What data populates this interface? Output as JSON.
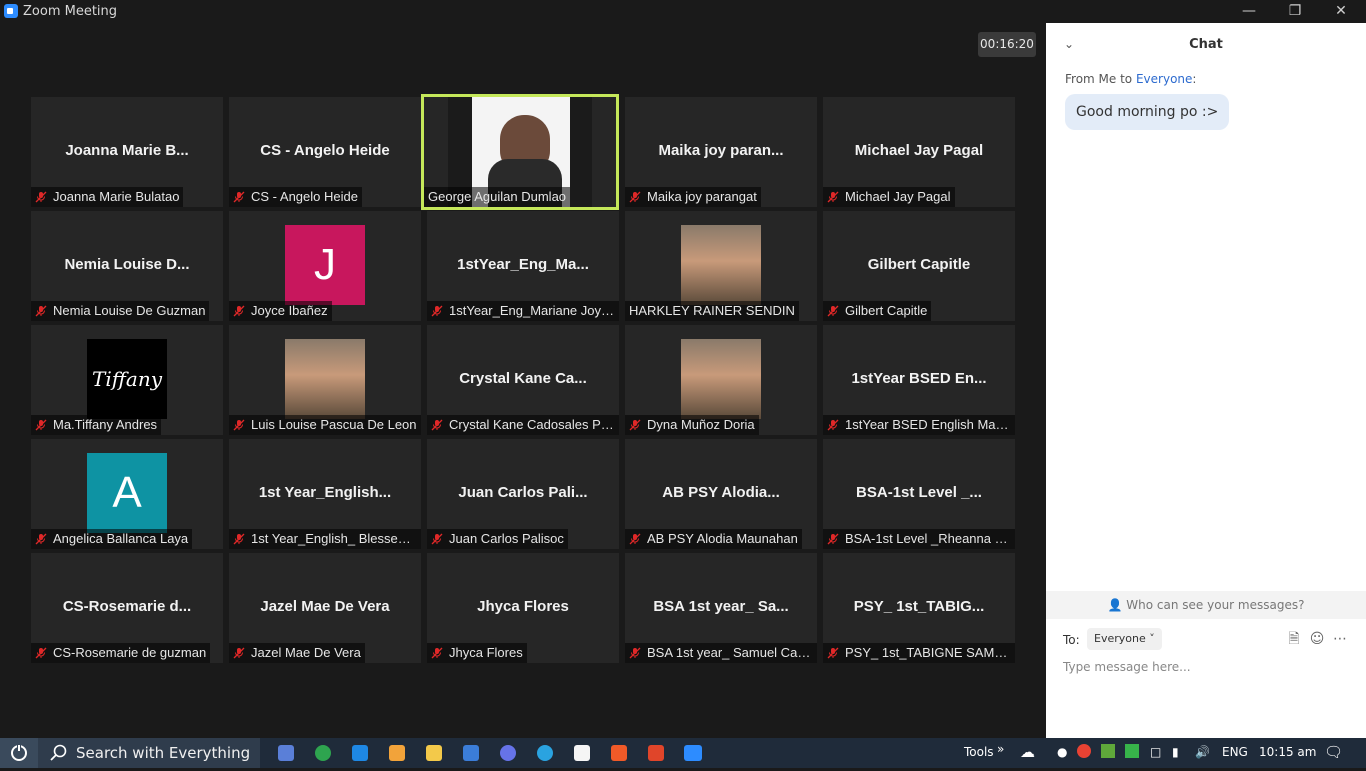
{
  "window": {
    "title": "Zoom Meeting"
  },
  "meeting": {
    "timer": "00:16:20",
    "tiles": [
      {
        "big": "Joanna  Marie  B...",
        "name": "Joanna Marie Bulatao",
        "muted": true
      },
      {
        "big": "CS - Angelo Heide",
        "name": "CS - Angelo Heide",
        "muted": true
      },
      {
        "big": "",
        "name": "George Aguilan Dumlao",
        "muted": false,
        "active": true,
        "video": true
      },
      {
        "big": "Maika  joy  paran...",
        "name": "Maika joy parangat",
        "muted": true
      },
      {
        "big": "Michael Jay Pagal",
        "name": "Michael Jay Pagal",
        "muted": true
      },
      {
        "big": "Nemia Louise D...",
        "name": "Nemia Louise De Guzman",
        "muted": true
      },
      {
        "big": "",
        "name": "Joyce Ibañez",
        "muted": true,
        "avatar_letter": "J",
        "avatar_color": "#c8175d"
      },
      {
        "big": "1stYear_Eng_Ma...",
        "name": "1stYear_Eng_Mariane Joy G...",
        "muted": true
      },
      {
        "big": "",
        "name": "HARKLEY RAINER SENDIN",
        "muted": false,
        "photo": true
      },
      {
        "big": "Gilbert Capitle",
        "name": "Gilbert Capitle",
        "muted": true
      },
      {
        "big": "",
        "name": "Ma.Tiffany Andres",
        "muted": true,
        "avatar_text": "Tiffany",
        "avatar_color": "#000000"
      },
      {
        "big": "",
        "name": "Luis Louise Pascua De Leon",
        "muted": true,
        "photo": true
      },
      {
        "big": "Crystal  Kane  Ca...",
        "name": "Crystal Kane Cadosales Pa...",
        "muted": true
      },
      {
        "big": "",
        "name": "Dyna Muñoz Doria",
        "muted": true,
        "photo": true
      },
      {
        "big": "1stYear  BSED  En...",
        "name": "1stYear BSED English Majo...",
        "muted": true
      },
      {
        "big": "",
        "name": "Angelica Ballanca Laya",
        "muted": true,
        "avatar_letter": "A",
        "avatar_color": "#0e93a3"
      },
      {
        "big": "1st  Year_English...",
        "name": "1st Year_English_ Blessed A...",
        "muted": true
      },
      {
        "big": "Juan  Carlos  Pali...",
        "name": "Juan Carlos Palisoc",
        "muted": true
      },
      {
        "big": "AB  PSY  Alodia...",
        "name": "AB PSY Alodia Maunahan",
        "muted": true
      },
      {
        "big": "BSA-1st  Level  _...",
        "name": "BSA-1st Level _Rheanna Jo...",
        "muted": true
      },
      {
        "big": "CS-Rosemarie  d...",
        "name": "CS-Rosemarie de guzman",
        "muted": true
      },
      {
        "big": "Jazel Mae De Vera",
        "name": "Jazel Mae De Vera",
        "muted": true
      },
      {
        "big": "Jhyca Flores",
        "name": "Jhyca Flores",
        "muted": true
      },
      {
        "big": "BSA  1st  year_  Sa...",
        "name": "BSA 1st year_ Samuel Card...",
        "muted": true
      },
      {
        "big": "PSY_  1st_TABIG...",
        "name": "PSY_ 1st_TABIGNE SAMANT...",
        "muted": true
      }
    ]
  },
  "chat": {
    "title": "Chat",
    "from_prefix": "From Me to ",
    "from_target": "Everyone",
    "from_suffix": ":",
    "message": "Good morning po :>",
    "who_can_see": "Who can see your messages?",
    "to_label": "To:",
    "to_value": "Everyone",
    "input_placeholder": "Type message here..."
  },
  "taskbar": {
    "search_placeholder": "Search with Everything",
    "tools_label": "Tools",
    "language": "ENG",
    "time": "10:15 am"
  }
}
